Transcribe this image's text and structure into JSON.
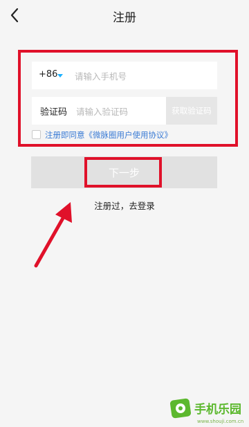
{
  "header": {
    "title": "注册",
    "back_icon": "chevron-left-icon"
  },
  "form": {
    "country_code": "+86",
    "phone_placeholder": "请输入手机号",
    "code_label": "验证码",
    "code_placeholder": "请输入验证码",
    "get_code_label": "获取验证码",
    "agreement_text": "注册即同意《微脉圈用户使用协议》"
  },
  "actions": {
    "next_label": "下一步",
    "login_link": "注册过，去登录"
  },
  "watermark": {
    "text": "手机乐园",
    "subtext": "www.shouji.com.cn"
  },
  "colors": {
    "annotation": "#e0112a",
    "accent": "#1ab0ff",
    "link": "#3a7bd5"
  }
}
